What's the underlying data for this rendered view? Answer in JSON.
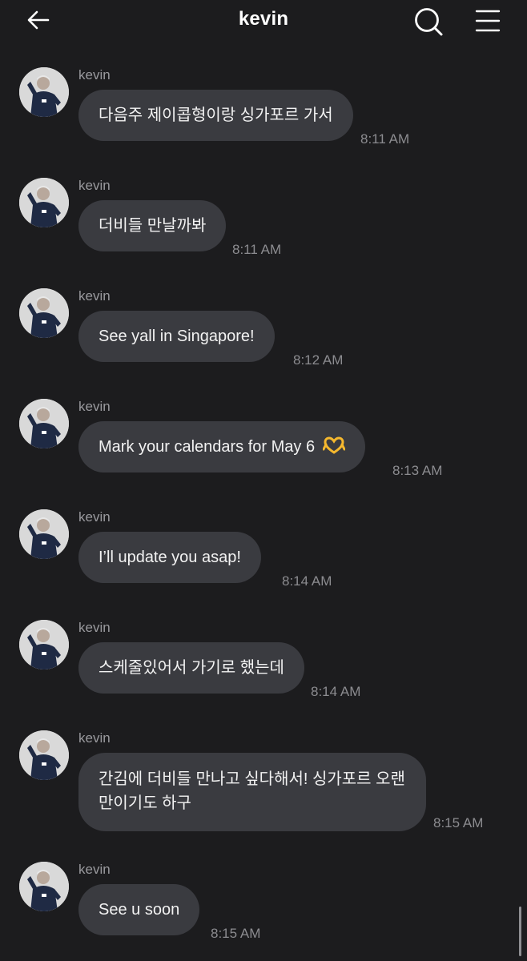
{
  "header": {
    "title": "kevin",
    "back_icon": "arrow-left-icon",
    "search_icon": "search-icon",
    "menu_icon": "hamburger-menu-icon"
  },
  "messages": [
    {
      "sender": "kevin",
      "text": "다음주 제이콥형이랑 싱가포르 가서",
      "time": "8:11 AM"
    },
    {
      "sender": "kevin",
      "text": "더비들 만날까봐",
      "time": "8:11 AM"
    },
    {
      "sender": "kevin",
      "text": "See yall in Singapore!",
      "time": "8:12 AM"
    },
    {
      "sender": "kevin",
      "text": "Mark your calendars for May 6",
      "emoji": "heart-hands-emoji",
      "time": "8:13 AM"
    },
    {
      "sender": "kevin",
      "text": "I’ll update you asap!",
      "time": "8:14 AM"
    },
    {
      "sender": "kevin",
      "text": "스케줄있어서 가기로 했는데",
      "time": "8:14 AM"
    },
    {
      "sender": "kevin",
      "text": "간김에 더비들 만나고 싶다해서! 싱가포르 오랜만이기도 하구",
      "time": "8:15 AM"
    },
    {
      "sender": "kevin",
      "text": "See u soon",
      "time": "8:15 AM"
    }
  ],
  "colors": {
    "background": "#1c1c1e",
    "bubble": "#3a3b40",
    "sender_text": "#9a9a9e",
    "time_text": "#8c8c90",
    "emoji_yellow": "#f5b82e"
  }
}
